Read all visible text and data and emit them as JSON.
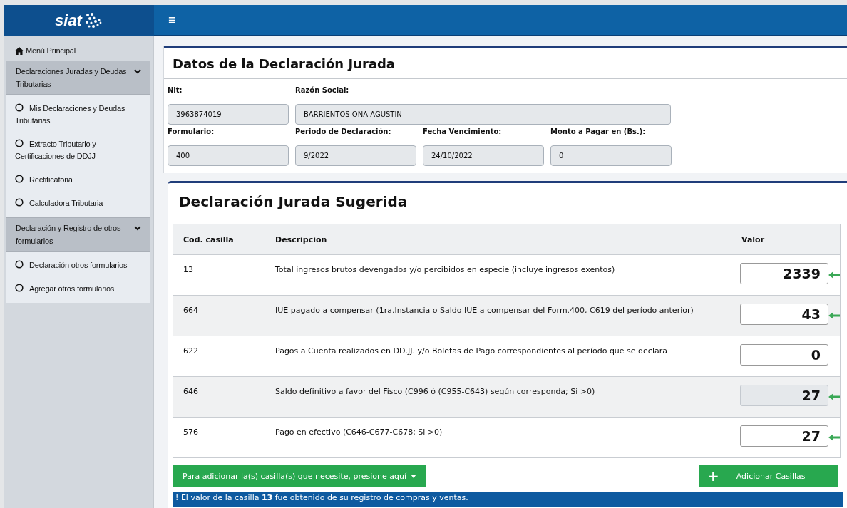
{
  "header": {
    "logo": "siat",
    "menu_icon": "≡"
  },
  "sidebar": {
    "home": "Menú Principal",
    "groups": [
      {
        "label": "Declaraciones Juradas y Deudas Tributarias",
        "expanded": true,
        "items": [
          {
            "label": "Mis Declaraciones y Deudas Tributarias"
          },
          {
            "label": "Extracto Tributario y Certificaciones de DDJJ"
          },
          {
            "label": "Rectificatoria"
          },
          {
            "label": "Calculadora Tributaria"
          }
        ]
      },
      {
        "label": "Declaración y Registro de otros formularios",
        "expanded": true,
        "items": [
          {
            "label": "Declaración otros formularios"
          },
          {
            "label": "Agregar otros formularios"
          }
        ]
      }
    ]
  },
  "datos": {
    "title": "Datos de la Declaración Jurada",
    "fields": [
      {
        "label": "Nit:",
        "value": "3963874019"
      },
      {
        "label": "Razón Social:",
        "value": "BARRIENTOS OÑA AGUSTIN"
      },
      {
        "label": "Formulario:",
        "value": "400"
      },
      {
        "label": "Periodo de Declaración:",
        "value": "9/2022"
      },
      {
        "label": "Fecha Vencimiento:",
        "value": "24/10/2022"
      },
      {
        "label": "Monto a Pagar en (Bs.):",
        "value": "0"
      }
    ]
  },
  "sugerida": {
    "title": "Declaración Jurada Sugerida",
    "columns": [
      "Cod. casilla",
      "Descripcion",
      "Valor"
    ],
    "rows": [
      {
        "code": "13",
        "description": "Total ingresos brutos devengados y/o percibidos en especie (incluye ingresos exentos)",
        "value": "2339",
        "disabled": false,
        "marked": true
      },
      {
        "code": "664",
        "description": "IUE pagado a compensar (1ra.Instancia o Saldo IUE a compensar del Form.400, C619 del período anterior)",
        "value": "43",
        "disabled": false,
        "marked": true
      },
      {
        "code": "622",
        "description": "Pagos a Cuenta realizados en DD.JJ. y/o Boletas de Pago correspondientes al período que se declara",
        "value": "0",
        "disabled": false,
        "marked": false
      },
      {
        "code": "646",
        "description": "Saldo definitivo a favor del Fisco (C996 ó (C955-C643) según corresponda; Si >0)",
        "value": "27",
        "disabled": true,
        "marked": true
      },
      {
        "code": "576",
        "description": "Pago en efectivo (C646-C677-C678; Si >0)",
        "value": "27",
        "disabled": false,
        "marked": true
      }
    ],
    "dropdown_button": "Para adicionar la(s) casilla(s) que necesite, presione aquí",
    "add_button": {
      "icon": "+",
      "label": "Adicionar Casillas"
    },
    "notice": "! El valor de la casilla **13** fue obtenido de su registro de compras y ventas."
  }
}
